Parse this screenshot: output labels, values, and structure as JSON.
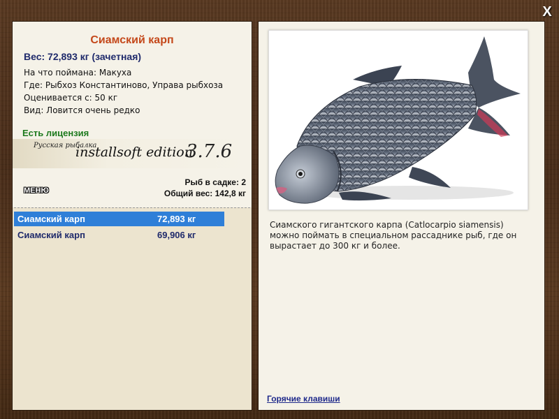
{
  "close_label": "X",
  "fish": {
    "name": "Сиамский карп",
    "weight_line": "Вес: 72,893 кг (зачетная)",
    "bait": "На что поймана: Макуха",
    "location": "Где: Рыбхоз Константиново, Управа рыбхоза",
    "value": "Оценивается с: 50 кг",
    "rarity": "Вид: Ловится очень редко"
  },
  "license_label": "Есть лицензия",
  "logo": {
    "small": "Русская рыбалка",
    "main": "installsoft edition",
    "version": "3.7.6"
  },
  "menu_label": "МЕНЮ",
  "cage": {
    "count_line": "Рыб в садке: 2",
    "total_line": "Общий вес: 142,8 кг"
  },
  "catches": [
    {
      "name": "Сиамский карп",
      "weight": "72,893 кг"
    },
    {
      "name": "Сиамский карп",
      "weight": "69,906 кг"
    }
  ],
  "description": "Сиамского гигантского карпа (Catlocarpio siamensis) можно поймать в специальном рассаднике рыб, где он вырастает до 300 кг и более.",
  "hotkeys_label": "Горячие клавиши",
  "colors": {
    "title": "#c4481a",
    "weight": "#1f2a6b",
    "license": "#1e7a1e",
    "selected_row": "#2f7fd8",
    "link": "#1f2a8b"
  }
}
